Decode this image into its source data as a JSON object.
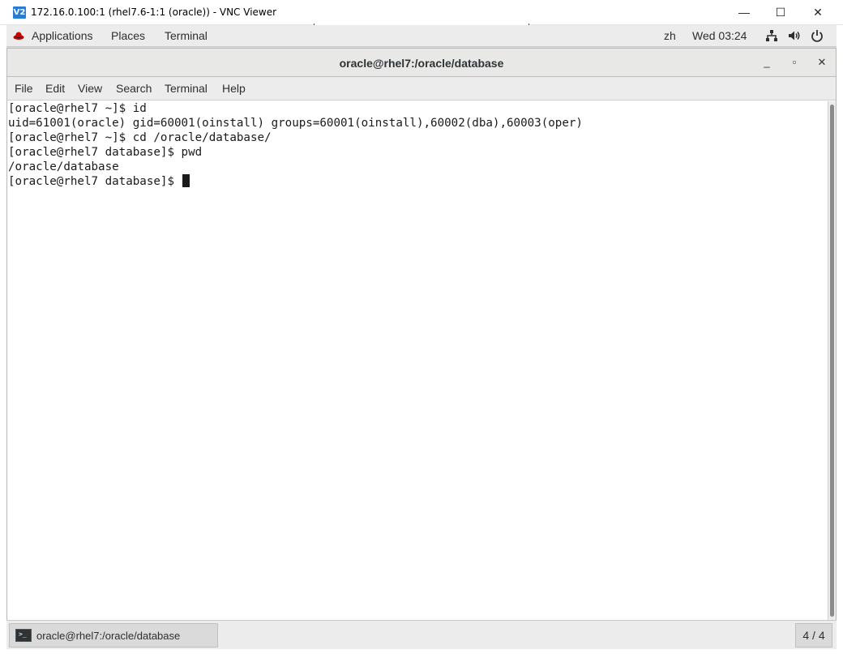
{
  "vnc_window": {
    "logo": "V2",
    "title": "172.16.0.100:1 (rhel7.6-1:1 (oracle)) - VNC Viewer",
    "controls": {
      "minimize": "—",
      "maximize": "☐",
      "close": "✕"
    }
  },
  "top_panel": {
    "applications": "Applications",
    "places": "Places",
    "terminal": "Terminal",
    "language": "zh",
    "clock": "Wed 03:24",
    "icons": [
      "network-icon",
      "volume-icon",
      "power-icon"
    ]
  },
  "terminal_window": {
    "title": "oracle@rhel7:/oracle/database",
    "controls": {
      "minimize": "_",
      "maximize": "▫",
      "close": "✕"
    },
    "menu": [
      "File",
      "Edit",
      "View",
      "Search",
      "Terminal",
      "Help"
    ],
    "lines": [
      "[oracle@rhel7 ~]$ id",
      "uid=61001(oracle) gid=60001(oinstall) groups=60001(oinstall),60002(dba),60003(oper)",
      "[oracle@rhel7 ~]$ cd /oracle/database/",
      "[oracle@rhel7 database]$ pwd",
      "/oracle/database",
      "[oracle@rhel7 database]$ "
    ]
  },
  "bottom_panel": {
    "task_label": "oracle@rhel7:/oracle/database",
    "task_icon_text": ">_",
    "workspace": "4 / 4"
  }
}
